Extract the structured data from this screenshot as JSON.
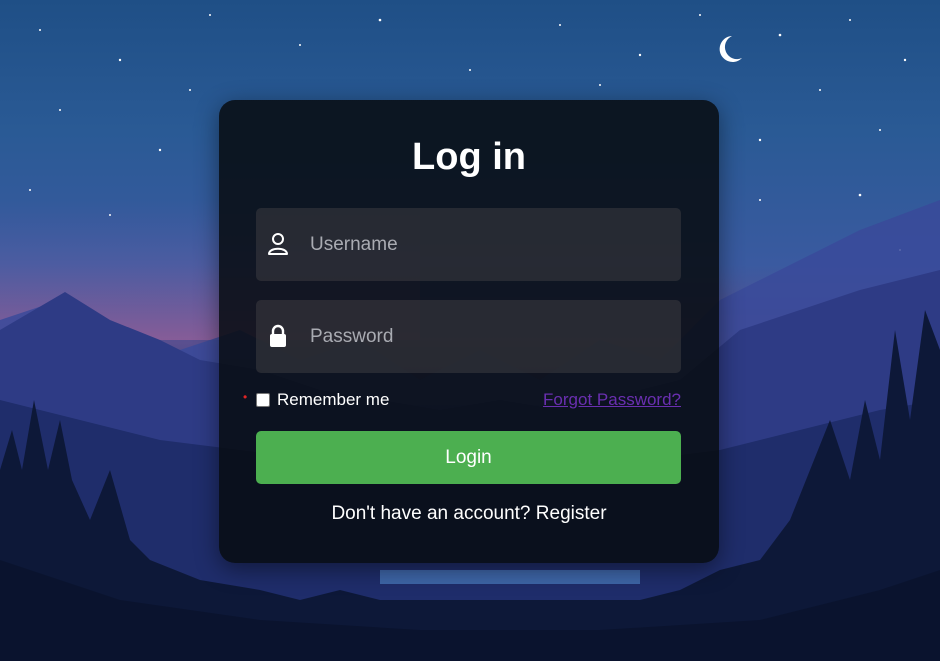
{
  "form": {
    "title": "Log in",
    "username_placeholder": "Username",
    "password_placeholder": "Password",
    "remember_label": "Remember me",
    "remember_checked": false,
    "forgot_label": "Forgot Password?",
    "login_label": "Login",
    "register_prompt": "Don't have an account?",
    "register_link": "Register"
  },
  "icons": {
    "username": "user-icon",
    "password": "lock-icon",
    "moon": "crescent-moon-icon"
  },
  "colors": {
    "login_button": "#4caf50",
    "forgot_link": "#6a2fb0",
    "required_marker": "#e02424"
  }
}
